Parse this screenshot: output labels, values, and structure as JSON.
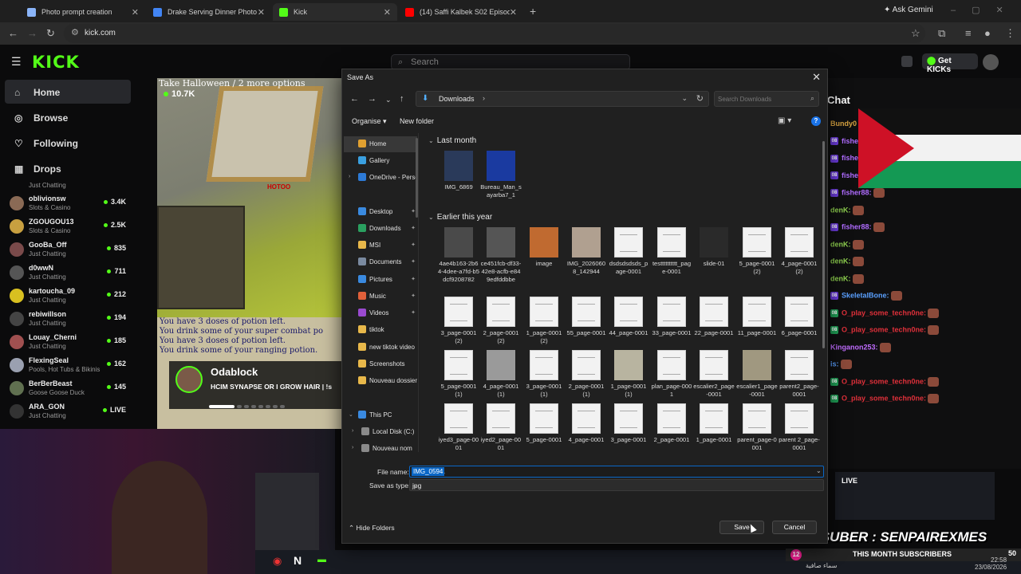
{
  "browser": {
    "tabs": [
      {
        "title": "Photo prompt creation",
        "icon_color": "#8ab4f8"
      },
      {
        "title": "Drake Serving Dinner Photo Pr",
        "icon_color": "#4285f4"
      },
      {
        "title": "Kick",
        "icon_color": "#53fc18"
      },
      {
        "title": "(14) Saffi Kalbek S02 Episode 0",
        "icon_color": "#ff0000"
      }
    ],
    "ask_gemini": "Ask Gemini",
    "url": "kick.com"
  },
  "kick": {
    "logo": "KICK",
    "search_placeholder": "Search",
    "get_kicks": "Get KICKs",
    "nav": [
      {
        "label": "Home",
        "icon": "home-icon"
      },
      {
        "label": "Browse",
        "icon": "compass-icon"
      },
      {
        "label": "Following",
        "icon": "heart-icon"
      },
      {
        "label": "Drops",
        "icon": "drops-icon"
      }
    ],
    "channels_partial_category": "Just Chatting",
    "channels": [
      {
        "name": "oblivionsw",
        "category": "Slots & Casino",
        "viewers": "3.4K",
        "color": "#8a6a55"
      },
      {
        "name": "ZGOUGOU13",
        "category": "Slots & Casino",
        "viewers": "2.5K",
        "color": "#c8a040"
      },
      {
        "name": "GooBa_Off",
        "category": "Just Chatting",
        "viewers": "835",
        "color": "#7a4a4a"
      },
      {
        "name": "d0wwN",
        "category": "Just Chatting",
        "viewers": "711",
        "color": "#555555"
      },
      {
        "name": "kartoucha_09",
        "category": "Just Chatting",
        "viewers": "212",
        "color": "#d8c020"
      },
      {
        "name": "rebiwillson",
        "category": "Just Chatting",
        "viewers": "194",
        "color": "#444444"
      },
      {
        "name": "Louay_Cherni",
        "category": "Just Chatting",
        "viewers": "185",
        "color": "#a05050"
      },
      {
        "name": "FlexingSeal",
        "category": "Pools, Hot Tubs & Bikinis",
        "viewers": "162",
        "color": "#9aa0b0"
      },
      {
        "name": "BerBerBeast",
        "category": "Goose Goose Duck",
        "viewers": "145",
        "color": "#607050"
      },
      {
        "name": "ARA_GON",
        "category": "Just Chatting",
        "viewers": "LIVE",
        "color": "#333333"
      }
    ],
    "video": {
      "viewers": "10.7K",
      "caption": "Take Halloween / 2 more options",
      "red_text": "HOTOO",
      "game_lines": [
        "You have 3 doses of potion left.",
        "You drink some of your super combat po",
        "You have 3 doses of potion left.",
        "You drink some of your ranging potion."
      ],
      "promo_name": "Odablock",
      "promo_title": "HCIM SYNAPSE OR I GROW HAIR | !s"
    }
  },
  "chat": {
    "title": "Chat",
    "messages": [
      {
        "user": "Bundy0",
        "color": "#d9a441",
        "badge": false,
        "emote": false
      },
      {
        "user": "fishe",
        "color": "#b06cff",
        "badge": true,
        "emote": false
      },
      {
        "user": "fishe",
        "color": "#b06cff",
        "badge": true,
        "emote": false
      },
      {
        "user": "fishe",
        "color": "#b06cff",
        "badge": true,
        "emote": false
      },
      {
        "user": "fisher88:",
        "color": "#b06cff",
        "badge": true,
        "emote": true
      },
      {
        "user": "denK:",
        "color": "#8fd14f",
        "badge": false,
        "emote": true
      },
      {
        "user": "fisher88:",
        "color": "#b06cff",
        "badge": true,
        "emote": true
      },
      {
        "user": "denK:",
        "color": "#8fd14f",
        "badge": false,
        "emote": true
      },
      {
        "user": "denK:",
        "color": "#8fd14f",
        "badge": false,
        "emote": true
      },
      {
        "user": "denK:",
        "color": "#8fd14f",
        "badge": false,
        "emote": true
      },
      {
        "user": "SkeletalBone:",
        "color": "#5aa0ff",
        "badge": true,
        "emote": true
      },
      {
        "user": "O_play_some_techn0ne:",
        "color": "#e0303a",
        "badge": true,
        "emote": true
      },
      {
        "user": "O_play_some_techn0ne:",
        "color": "#e0303a",
        "badge": true,
        "emote": true
      },
      {
        "user": "Kinganon253:",
        "color": "#c06cff",
        "badge": false,
        "emote": true
      },
      {
        "user": "is:",
        "color": "#5aa0ff",
        "badge": false,
        "emote": true
      },
      {
        "user": "O_play_some_techn0ne:",
        "color": "#e0303a",
        "badge": true,
        "emote": true
      },
      {
        "user": "O_play_some_techn0ne:",
        "color": "#e0303a",
        "badge": true,
        "emote": true
      }
    ],
    "live_label": "LIVE"
  },
  "overlay": {
    "top_suber": "TOP SUBER : SENPAIREXMES",
    "sub_count": "12",
    "sub_title": "THIS MONTH SUBSCRIBERS",
    "sub_goal": "50",
    "arabic_text": "سماء صافية",
    "clock_time": "22:58",
    "clock_date": "23/08/2026"
  },
  "dialog": {
    "title": "Save As",
    "path": "Downloads",
    "search_placeholder": "Search Downloads",
    "organise": "Organise",
    "new_folder": "New folder",
    "nav_items": [
      {
        "label": "Home",
        "icon_color": "#e0a030",
        "pin": false,
        "expand": "",
        "selected": true
      },
      {
        "label": "Gallery",
        "icon_color": "#3aa0e0",
        "pin": false,
        "expand": "",
        "selected": false
      },
      {
        "label": "OneDrive - Perso",
        "icon_color": "#2d7ad6",
        "pin": false,
        "expand": "›",
        "selected": false
      },
      {
        "label": "Desktop",
        "icon_color": "#3a8ae0",
        "pin": true,
        "expand": "",
        "selected": false
      },
      {
        "label": "Downloads",
        "icon_color": "#2aa060",
        "pin": true,
        "expand": "",
        "selected": false
      },
      {
        "label": "MSI",
        "icon_color": "#e8b84a",
        "pin": true,
        "expand": "",
        "selected": false
      },
      {
        "label": "Documents",
        "icon_color": "#7a8aa0",
        "pin": true,
        "expand": "",
        "selected": false
      },
      {
        "label": "Pictures",
        "icon_color": "#3a8ae0",
        "pin": true,
        "expand": "",
        "selected": false
      },
      {
        "label": "Music",
        "icon_color": "#e0603a",
        "pin": true,
        "expand": "",
        "selected": false
      },
      {
        "label": "Videos",
        "icon_color": "#9a4ad0",
        "pin": true,
        "expand": "",
        "selected": false
      },
      {
        "label": "tiktok",
        "icon_color": "#e8b84a",
        "pin": false,
        "expand": "",
        "selected": false
      },
      {
        "label": "new tiktok video",
        "icon_color": "#e8b84a",
        "pin": false,
        "expand": "",
        "selected": false
      },
      {
        "label": "Screenshots",
        "icon_color": "#e8b84a",
        "pin": false,
        "expand": "",
        "selected": false
      },
      {
        "label": "Nouveau dossier",
        "icon_color": "#e8b84a",
        "pin": false,
        "expand": "",
        "selected": false
      },
      {
        "label": "This PC",
        "icon_color": "#3a8ae0",
        "pin": false,
        "expand": "⌄",
        "selected": false
      },
      {
        "label": "Local Disk (C:)",
        "icon_color": "#8a8a8a",
        "pin": false,
        "expand": "›",
        "selected": false
      },
      {
        "label": "Nouveau nom",
        "icon_color": "#8a8a8a",
        "pin": false,
        "expand": "›",
        "selected": false
      }
    ],
    "groups": [
      {
        "label": "Last month",
        "files": [
          {
            "name": "IMG_6869",
            "thumb": "photo",
            "color": "#2a3a5a"
          },
          {
            "name": "Bureau_Man_sayarba7_1",
            "thumb": "photo",
            "color": "#1a3aa0"
          }
        ]
      },
      {
        "label": "Earlier this year",
        "files": [
          {
            "name": "4ae4b163-2b64-4dee-a7fd-b5dcf9208782",
            "thumb": "photo",
            "color": "#4a4a4a"
          },
          {
            "name": "ce451fcb-df33-42e8-acfb-e849edfddbbe",
            "thumb": "photo",
            "color": "#555555"
          },
          {
            "name": "image",
            "thumb": "photo",
            "color": "#c06a30"
          },
          {
            "name": "IMG_20260608_142944",
            "thumb": "photo",
            "color": "#b0a090"
          },
          {
            "name": "dsdsdsdsds_page-0001",
            "thumb": "doc",
            "color": ""
          },
          {
            "name": "testttttttttt_page-0001",
            "thumb": "doc",
            "color": ""
          },
          {
            "name": "slide-01",
            "thumb": "photo",
            "color": "#2a2a2a"
          },
          {
            "name": "5_page-0001 (2)",
            "thumb": "doc",
            "color": ""
          },
          {
            "name": "4_page-0001 (2)",
            "thumb": "doc",
            "color": ""
          },
          {
            "name": "3_page-0001 (2)",
            "thumb": "doc",
            "color": ""
          },
          {
            "name": "2_page-0001 (2)",
            "thumb": "doc",
            "color": ""
          },
          {
            "name": "1_page-0001 (2)",
            "thumb": "doc",
            "color": ""
          },
          {
            "name": "55_page-0001",
            "thumb": "doc",
            "color": ""
          },
          {
            "name": "44_page-0001",
            "thumb": "doc",
            "color": ""
          },
          {
            "name": "33_page-0001",
            "thumb": "doc",
            "color": ""
          },
          {
            "name": "22_page-0001",
            "thumb": "doc",
            "color": ""
          },
          {
            "name": "11_page-0001",
            "thumb": "doc",
            "color": ""
          },
          {
            "name": "6_page-0001",
            "thumb": "doc",
            "color": ""
          },
          {
            "name": "5_page-0001 (1)",
            "thumb": "doc",
            "color": ""
          },
          {
            "name": "4_page-0001 (1)",
            "thumb": "photo",
            "color": "#9a9a9a"
          },
          {
            "name": "3_page-0001 (1)",
            "thumb": "doc",
            "color": ""
          },
          {
            "name": "2_page-0001 (1)",
            "thumb": "doc",
            "color": ""
          },
          {
            "name": "1_page-0001 (1)",
            "thumb": "photo",
            "color": "#b8b4a0"
          },
          {
            "name": "plan_page-0001",
            "thumb": "doc",
            "color": ""
          },
          {
            "name": "escalier2_page-0001",
            "thumb": "doc",
            "color": ""
          },
          {
            "name": "escalier1_page-0001",
            "thumb": "photo",
            "color": "#a09880"
          },
          {
            "name": "parent2_page-0001",
            "thumb": "doc",
            "color": ""
          },
          {
            "name": "iyed3_page-0001",
            "thumb": "doc",
            "color": ""
          },
          {
            "name": "iyed2_page-0001",
            "thumb": "doc",
            "color": ""
          },
          {
            "name": "5_page-0001",
            "thumb": "doc",
            "color": ""
          },
          {
            "name": "4_page-0001",
            "thumb": "doc",
            "color": ""
          },
          {
            "name": "3_page-0001",
            "thumb": "doc",
            "color": ""
          },
          {
            "name": "2_page-0001",
            "thumb": "doc",
            "color": ""
          },
          {
            "name": "1_page-0001",
            "thumb": "doc",
            "color": ""
          },
          {
            "name": "parent_page-0001",
            "thumb": "doc",
            "color": ""
          },
          {
            "name": "parent 2_page-0001",
            "thumb": "doc",
            "color": ""
          }
        ]
      }
    ],
    "file_name_label": "File name:",
    "file_name_value": "IMG_0594",
    "save_type_label": "Save as type:",
    "save_type_value": "jpg",
    "hide_folders": "Hide Folders",
    "save": "Save",
    "cancel": "Cancel"
  }
}
